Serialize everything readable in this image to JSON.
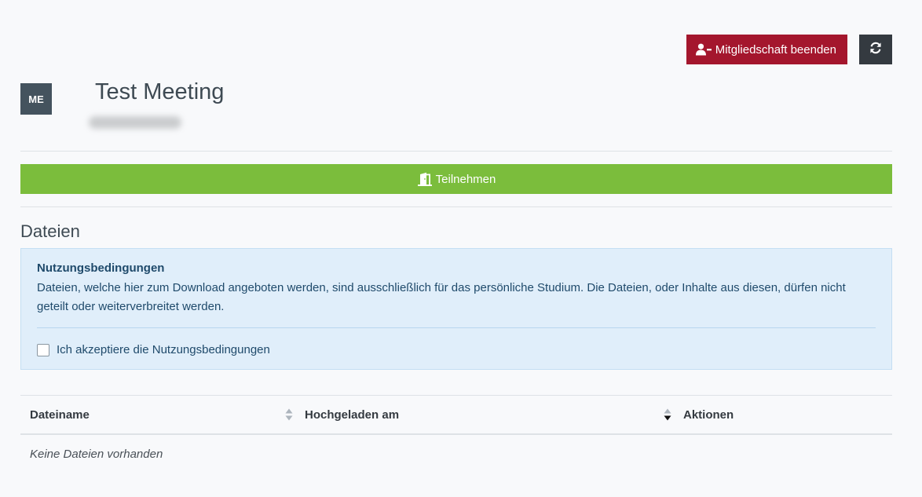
{
  "header": {
    "end_membership_label": "Mitgliedschaft beenden",
    "end_membership_icon": "user-minus-icon",
    "refresh_icon": "refresh-icon"
  },
  "room": {
    "avatar_initials": "ME",
    "title": "Test Meeting"
  },
  "join": {
    "label": "Teilnehmen",
    "icon": "door-open-icon",
    "color": "#7bbd3c"
  },
  "files": {
    "section_title": "Dateien",
    "terms": {
      "title": "Nutzungsbedingungen",
      "text": "Dateien, welche hier zum Download angeboten werden, sind ausschließlich für das persönliche Studium. Die Dateien, oder Inhalte aus diesen, dürfen nicht geteilt oder weiterverbreitet werden.",
      "checkbox_label": "Ich akzeptiere die Nutzungsbedingungen",
      "accepted": false
    },
    "table": {
      "columns": [
        "Dateiname",
        "Hochgeladen am",
        "Aktionen"
      ],
      "empty_message": "Keine Dateien vorhanden"
    }
  },
  "colors": {
    "danger": "#a4162d",
    "dark": "#343a40",
    "success": "#7bbd3c",
    "info_bg": "#e0eefa",
    "avatar_bg": "#44535e"
  }
}
